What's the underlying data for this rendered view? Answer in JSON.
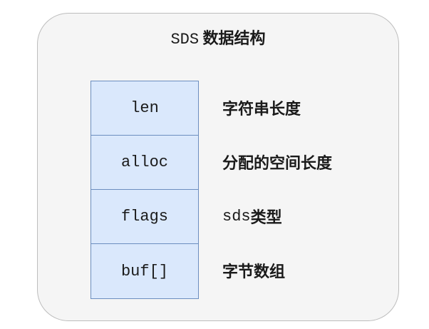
{
  "title": {
    "code": "SDS",
    "text": "数据结构"
  },
  "fields": [
    {
      "name": "len",
      "desc_code": "",
      "desc_text": "字符串长度"
    },
    {
      "name": "alloc",
      "desc_code": "",
      "desc_text": "分配的空间长度"
    },
    {
      "name": "flags",
      "desc_code": "sds",
      "desc_text": "类型"
    },
    {
      "name": "buf[]",
      "desc_code": "",
      "desc_text": "字节数组"
    }
  ],
  "colors": {
    "panel_fill": "#f5f5f5",
    "panel_border": "#bdbdbd",
    "field_fill": "#dae8fc",
    "field_border": "#6c8ebf"
  }
}
